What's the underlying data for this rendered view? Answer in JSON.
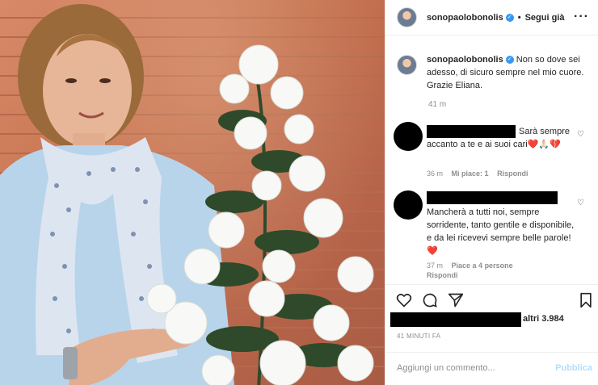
{
  "post": {
    "username": "sonopaolobonolis",
    "follow_label": "Segui già",
    "dot": "•",
    "more": "···"
  },
  "caption": {
    "username": "sonopaolobonolis",
    "text": "Non so dove sei adesso, di sicuro sempre nel mio cuore. Grazie Eliana.",
    "time": "41 m"
  },
  "comments": [
    {
      "text": "Sarà sempre accanto a te e ai suoi cari❤️🙏🏻💔",
      "time": "36 m",
      "likes": "Mi piace: 1",
      "reply": "Rispondi"
    },
    {
      "text": "Mancherà a tutti noi, sempre sorridente, tanto gentile e disponibile, e da lei ricevevi sempre belle parole! ❤️",
      "time": "37 m",
      "likes": "Piace a 4 persone",
      "reply": "Rispondi"
    }
  ],
  "likes_text": "altri 3.984",
  "timestamp": "41 MINUTI FA",
  "add_comment_placeholder": "Aggiungi un commento...",
  "publish_label": "Pubblica",
  "colors": {
    "verified": "#3897f0",
    "publish": "#b2dffc",
    "muted": "#8e8e8e"
  }
}
